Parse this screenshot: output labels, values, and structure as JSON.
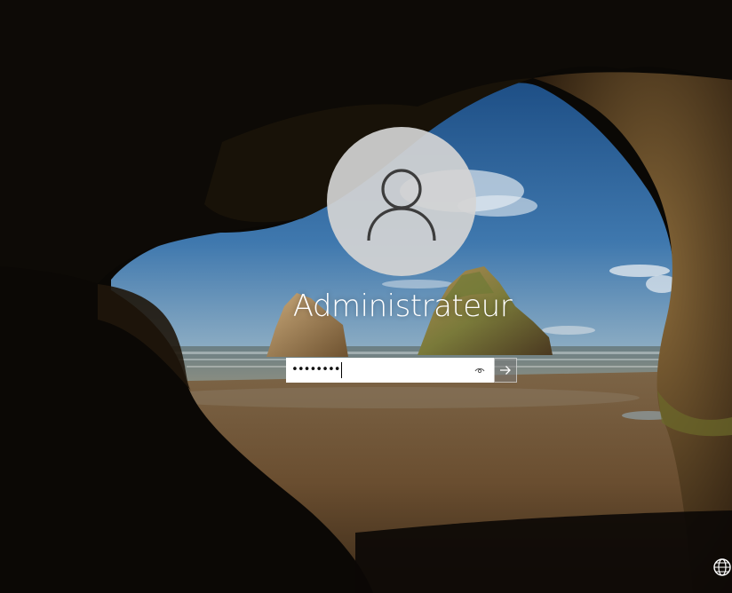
{
  "lock_screen": {
    "user_name": "Administrateur",
    "password_masked": "••••••••",
    "avatar_icon": "user-icon",
    "reveal_icon": "eye-icon",
    "submit_icon": "arrow-right-icon",
    "corner_icon": "network-globe-icon"
  },
  "colors": {
    "avatar_bg": "#d4d4d4",
    "text": "#ffffff",
    "field_bg": "#ffffff",
    "submit_bg": "#7a7a7a"
  }
}
